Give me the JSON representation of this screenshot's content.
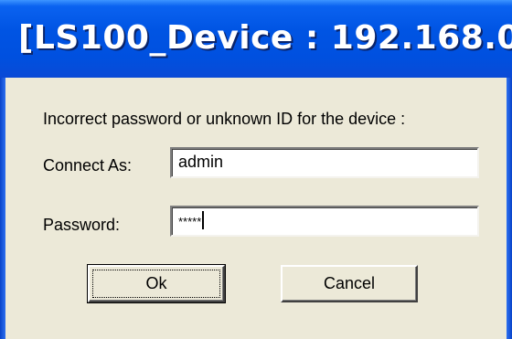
{
  "window": {
    "title": "[LS100_Device : 192.168.0..."
  },
  "dialog": {
    "message": "Incorrect password or unknown ID for the device :",
    "connect_as_label": "Connect As:",
    "connect_as_value": "admin",
    "password_label": "Password:",
    "password_value": "*****",
    "ok_label": "Ok",
    "cancel_label": "Cancel"
  }
}
